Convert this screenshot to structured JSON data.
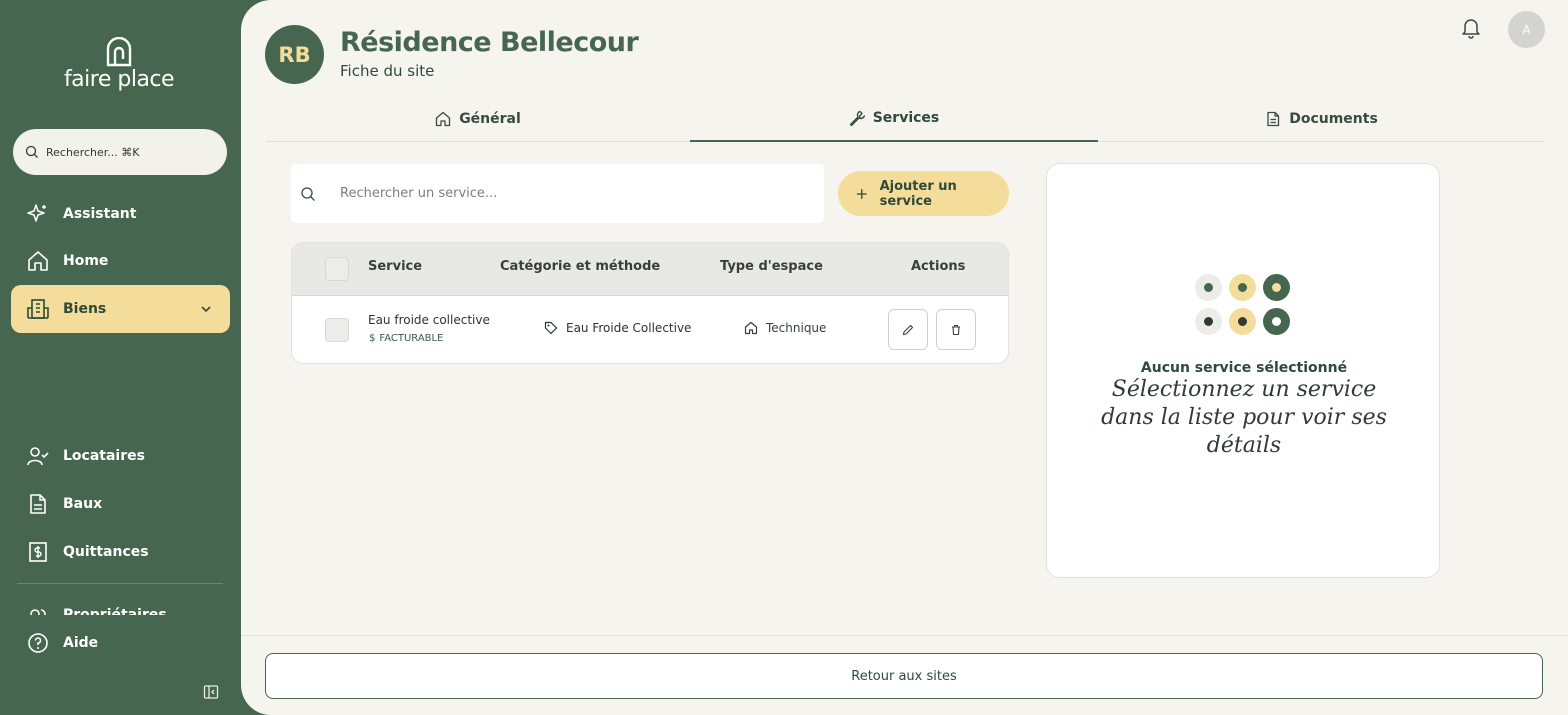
{
  "brand": {
    "name": "faire place"
  },
  "search": {
    "label": "Rechercher... ⌘K"
  },
  "nav": {
    "items": [
      {
        "label": "Assistant",
        "icon": "sparkle-icon"
      },
      {
        "label": "Home",
        "icon": "home-icon"
      },
      {
        "label": "Biens",
        "icon": "building-icon",
        "active": true
      },
      {
        "label": "Locataires",
        "icon": "user-check-icon"
      },
      {
        "label": "Baux",
        "icon": "document-icon"
      },
      {
        "label": "Quittances",
        "icon": "receipt-icon"
      },
      {
        "label": "Propriétaires",
        "icon": "users-icon"
      },
      {
        "label": "Aide",
        "icon": "help-icon"
      }
    ]
  },
  "header": {
    "initials": "RB",
    "title": "Résidence Bellecour",
    "subtitle": "Fiche du site",
    "user_initial": "A"
  },
  "tabs": [
    {
      "label": "Général",
      "icon": "home-icon"
    },
    {
      "label": "Services",
      "icon": "wrench-icon",
      "active": true
    },
    {
      "label": "Documents",
      "icon": "document-icon"
    }
  ],
  "services": {
    "search_placeholder": "Rechercher un service...",
    "add_label": "Ajouter un service",
    "columns": [
      "Service",
      "Catégorie et méthode",
      "Type d'espace",
      "Actions"
    ],
    "rows": [
      {
        "name": "Eau froide collective",
        "billing": "FACTURABLE",
        "category": "Eau Froide Collective",
        "space_type": "Technique"
      }
    ]
  },
  "detail": {
    "empty_title": "Aucun service sélectionné",
    "empty_subtitle": "Sélectionnez un service dans la liste pour voir ses détails"
  },
  "footer": {
    "back_label": "Retour aux sites"
  },
  "colors": {
    "sidebar": "#46664f",
    "accent": "#f4dc9b",
    "background": "#f5f4ef"
  }
}
